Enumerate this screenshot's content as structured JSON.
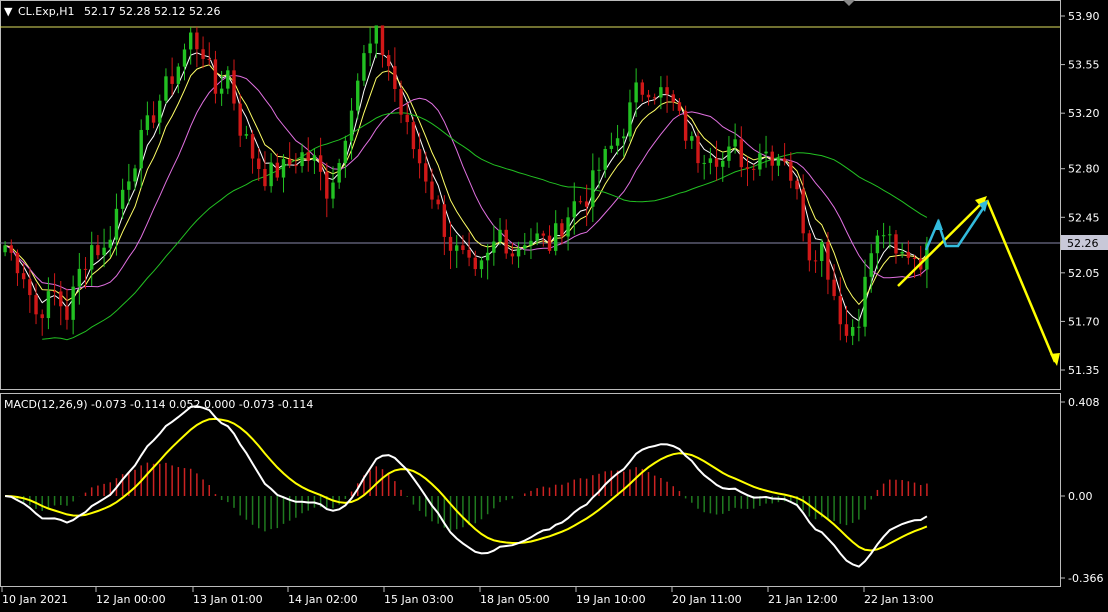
{
  "header": {
    "menu_glyph": "▼",
    "symbol": "CL.Exp,H1",
    "ohlc": "52.17 52.28 52.12 52.26"
  },
  "price_axis": {
    "ticks": [
      "53.90",
      "53.55",
      "53.20",
      "52.80",
      "52.45",
      "52.05",
      "51.70",
      "51.35"
    ],
    "tick_values": [
      53.9,
      53.55,
      53.2,
      52.8,
      52.45,
      52.05,
      51.7,
      51.35
    ],
    "current_price": "52.26",
    "current_value": 52.26
  },
  "indicator": {
    "label": "MACD(12,26,9) -0.073 -0.114 0.052 0.000 -0.073 -0.114",
    "ticks": [
      "0.408",
      "0.00",
      "-0.366"
    ],
    "tick_values": [
      0.408,
      0.0,
      -0.366
    ]
  },
  "time_axis": {
    "labels": [
      "10 Jan 2021",
      "12 Jan 00:00",
      "13 Jan 01:00",
      "14 Jan 02:00",
      "15 Jan 03:00",
      "18 Jan 05:00",
      "19 Jan 10:00",
      "20 Jan 11:00",
      "21 Jan 12:00",
      "22 Jan 13:00"
    ]
  },
  "colors": {
    "background": "#000000",
    "bull_candle": "#22c022",
    "bear_candle": "#d01818",
    "ma_fast": "#ffffff",
    "ma_mid": "#ffff66",
    "ma_slow": "#e070e0",
    "ma_long": "#22c022",
    "macd_line": "#ffffff",
    "signal_line": "#ffff00",
    "hist_pos": "#cc2222",
    "hist_neg": "#1f7a1f",
    "arrow_yellow": "#ffff00",
    "arrow_cyan": "#33bbdd",
    "border": "#bbbbbb",
    "high_line": "#e0e060",
    "price_line": "#8888aa"
  },
  "chart_data": {
    "type": "candlestick",
    "xlabel": "",
    "ylabel": "",
    "ylim": [
      51.2,
      54.0
    ],
    "bars": 150,
    "price_path": [
      [
        0,
        52.25
      ],
      [
        3,
        52.05
      ],
      [
        5,
        51.75
      ],
      [
        8,
        51.9
      ],
      [
        10,
        51.75
      ],
      [
        12,
        52.05
      ],
      [
        14,
        52.25
      ],
      [
        16,
        52.2
      ],
      [
        19,
        52.65
      ],
      [
        22,
        53.0
      ],
      [
        25,
        53.3
      ],
      [
        28,
        53.55
      ],
      [
        30,
        53.75
      ],
      [
        32,
        53.65
      ],
      [
        34,
        53.35
      ],
      [
        36,
        53.5
      ],
      [
        38,
        53.1
      ],
      [
        40,
        52.9
      ],
      [
        42,
        52.75
      ],
      [
        45,
        52.8
      ],
      [
        48,
        52.9
      ],
      [
        50,
        52.85
      ],
      [
        52,
        52.65
      ],
      [
        54,
        52.85
      ],
      [
        56,
        53.3
      ],
      [
        58,
        53.6
      ],
      [
        60,
        53.75
      ],
      [
        62,
        53.55
      ],
      [
        64,
        53.2
      ],
      [
        66,
        52.95
      ],
      [
        68,
        52.75
      ],
      [
        70,
        52.5
      ],
      [
        72,
        52.25
      ],
      [
        74,
        52.15
      ],
      [
        76,
        52.0
      ],
      [
        78,
        52.15
      ],
      [
        80,
        52.35
      ],
      [
        82,
        52.2
      ],
      [
        84,
        52.3
      ],
      [
        86,
        52.3
      ],
      [
        88,
        52.25
      ],
      [
        90,
        52.4
      ],
      [
        92,
        52.55
      ],
      [
        94,
        52.6
      ],
      [
        96,
        52.8
      ],
      [
        98,
        52.95
      ],
      [
        100,
        53.1
      ],
      [
        102,
        53.35
      ],
      [
        104,
        53.4
      ],
      [
        106,
        53.35
      ],
      [
        108,
        53.25
      ],
      [
        110,
        53.05
      ],
      [
        112,
        52.9
      ],
      [
        114,
        52.95
      ],
      [
        116,
        52.85
      ],
      [
        118,
        52.95
      ],
      [
        120,
        52.8
      ],
      [
        122,
        52.95
      ],
      [
        124,
        52.9
      ],
      [
        126,
        52.9
      ],
      [
        128,
        52.6
      ],
      [
        130,
        52.2
      ],
      [
        132,
        52.25
      ],
      [
        134,
        51.9
      ],
      [
        136,
        51.6
      ],
      [
        138,
        51.75
      ],
      [
        140,
        52.2
      ],
      [
        142,
        52.35
      ],
      [
        144,
        52.15
      ],
      [
        146,
        52.2
      ],
      [
        148,
        52.15
      ],
      [
        149,
        52.26
      ]
    ],
    "high": 53.82,
    "low": 51.32,
    "current": 52.26,
    "macd_ylim": [
      -0.366,
      0.408
    ]
  }
}
